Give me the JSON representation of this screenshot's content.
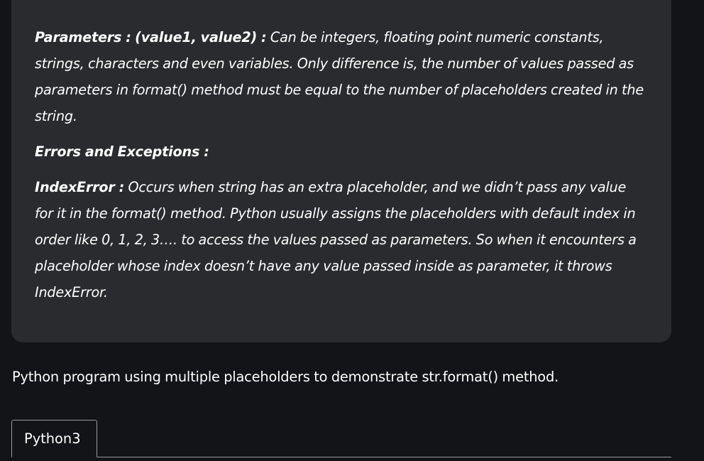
{
  "note": {
    "parameters": {
      "label": "Parameters :",
      "param_names": "(value1, value2) :",
      "text": "Can be integers, floating point numeric constants, strings, characters and even variables. Only difference is, the number of values passed as parameters in format() method must be equal to the number of placeholders created in the string."
    },
    "errors_heading": "Errors and Exceptions :",
    "index_error": {
      "label": "IndexError :",
      "text": "Occurs when string has an extra placeholder, and we didn’t pass any value for it in the format() method. Python usually assigns the placeholders with default index in order like 0, 1, 2, 3…. to access the values passed as parameters. So when it encounters a placeholder whose index doesn’t have any value passed inside as parameter, it throws IndexError."
    }
  },
  "intro_text": "Python program using multiple placeholders to demonstrate str.format() method.",
  "code_tabs": [
    {
      "label": "Python3",
      "active": true
    }
  ]
}
